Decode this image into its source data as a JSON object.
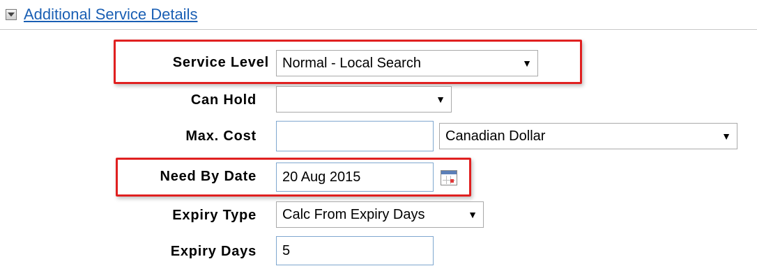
{
  "section": {
    "title": "Additional Service Details",
    "toggle_icon": "collapse-triangle-icon"
  },
  "form": {
    "service_level": {
      "label": "Service Level",
      "value": "Normal - Local Search"
    },
    "can_hold": {
      "label": "Can Hold",
      "value": ""
    },
    "max_cost": {
      "label": "Max. Cost",
      "value": "",
      "currency": "Canadian Dollar"
    },
    "need_by_date": {
      "label": "Need By Date",
      "value": "20 Aug 2015",
      "calendar_icon": "calendar-icon"
    },
    "expiry_type": {
      "label": "Expiry Type",
      "value": "Calc From Expiry Days"
    },
    "expiry_days": {
      "label": "Expiry Days",
      "value": "5"
    }
  },
  "colors": {
    "link": "#1a5fb4",
    "highlight": "#e02020",
    "input_border": "#7fa7cf"
  }
}
